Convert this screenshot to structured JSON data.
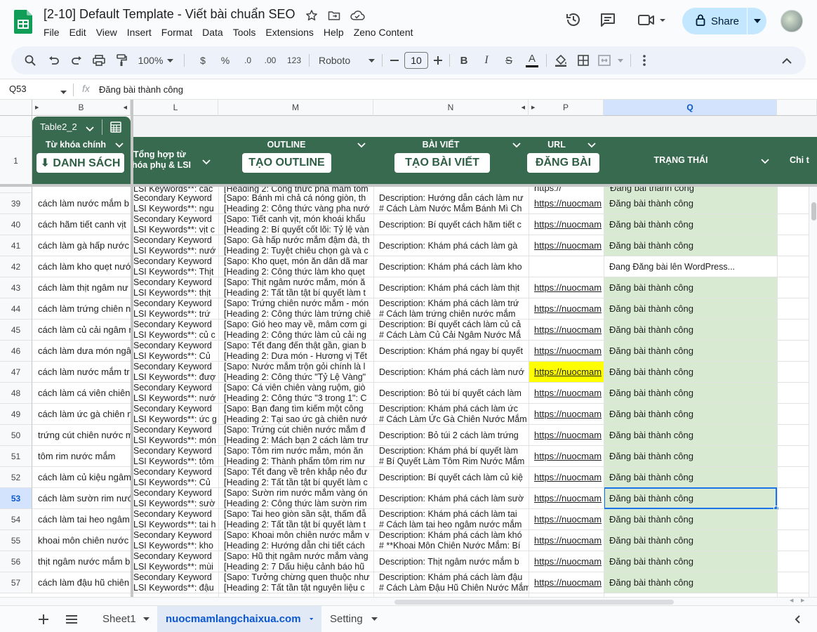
{
  "doc": {
    "title": "[2-10] Default Template - Viết bài chuẩn SEO",
    "menu": [
      "File",
      "Edit",
      "View",
      "Insert",
      "Format",
      "Data",
      "Tools",
      "Extensions",
      "Help",
      "Zeno Content"
    ],
    "share_label": "Share"
  },
  "toolbar": {
    "zoom": "100%",
    "currency": "$",
    "percent": "%",
    "dec_less": ".0",
    "dec_more": ".00",
    "number_format": "123",
    "font": "Roboto",
    "font_size": "10",
    "bold": "B",
    "italic": "I",
    "strike": "S",
    "text_color": "A"
  },
  "formula_bar": {
    "cell_ref": "Q53",
    "fx": "fx",
    "content": "Đăng bài thành công"
  },
  "columns": {
    "B": "B",
    "L": "L",
    "M": "M",
    "N": "N",
    "P": "P",
    "Q": "Q"
  },
  "table": {
    "chip_name": "Table2_2",
    "header_row_num": "1",
    "headers": {
      "B": "Từ khóa chính",
      "L_line1": "Tổng hợp từ",
      "L_line2": "hóa phụ & LSI",
      "M": "OUTLINE",
      "N": "BÀI VIẾT",
      "P": "URL",
      "Q": "TRẠNG THÁI",
      "R": "Chi t"
    },
    "buttons": {
      "B": "⬇ DANH SÁCH",
      "M": "TẠO OUTLINE",
      "N": "TẠO BÀI VIẾT",
      "P": "ĐĂNG BÀI"
    }
  },
  "top_partial": {
    "L": "LSI Keywords**: các",
    "M": "[Heading 2: Công thức pha mắm tôm",
    "N": "",
    "P": "https://",
    "Q": "Đăng bài thành công"
  },
  "rows": [
    {
      "num": "39",
      "B": "cách làm nước mắm b",
      "L1": "Secondary Keyword",
      "L2": "LSI Keywords**: ngu",
      "M1": "[Sapo: Bánh mì chả cá nóng giòn, th",
      "M2": "[Heading 2: Công thức vàng pha nướ",
      "N1": "Description: Hướng dẫn cách làm nư",
      "N2": "# Cách Làm Nước Mắm Bánh Mì Ch",
      "P": "https://nuocmam",
      "Q": "Đăng bài thành công"
    },
    {
      "num": "40",
      "B": "cách hãm tiết canh vịt",
      "L1": "Secondary Keyword",
      "L2": "LSI Keywords**: vịt c",
      "M1": "[Sapo: Tiết canh vịt, món khoái khẩu",
      "M2": "[Heading 2: Bí quyết cốt lõi: Tỷ lệ vàn",
      "N1": "Description: Bí quyết cách hãm tiết c",
      "N2": "",
      "P": "https://nuocmam",
      "Q": "Đăng bài thành công"
    },
    {
      "num": "41",
      "B": "cách làm gà hấp nước",
      "L1": "Secondary Keyword",
      "L2": "LSI Keywords**: nướ",
      "M1": "[Sapo: Gà hấp nước mắm đậm đà, th",
      "M2": "[Heading 2: Tuyệt chiêu chọn gà và c",
      "N1": "Description: Khám phá cách làm gà",
      "N2": "",
      "P": "https://nuocmam",
      "Q": "Đăng bài thành công"
    },
    {
      "num": "42",
      "B": "cách làm kho quẹt nước",
      "L1": "Secondary Keyword",
      "L2": "LSI Keywords**: Thịt",
      "M1": "[Sapo: Kho quẹt, món ăn dân dã mar",
      "M2": "[Heading 2: Công thức làm kho quẹt",
      "N1": "Description: Khám phá cách làm kho",
      "N2": "",
      "P": "",
      "Q": "Đang Đăng bài lên WordPress..."
    },
    {
      "num": "43",
      "B": "cách làm thịt ngâm nư",
      "L1": "Secondary Keyword",
      "L2": "LSI Keywords**: thịt",
      "M1": "[Sapo: Thịt ngâm nước mắm, món ă",
      "M2": "[Heading 2: Tất tần tật bí quyết làm t",
      "N1": "Description: Khám phá cách làm thịt",
      "N2": "",
      "P": "https://nuocmam",
      "Q": "Đăng bài thành công"
    },
    {
      "num": "44",
      "B": "cách làm trứng chiên n",
      "L1": "Secondary Keyword",
      "L2": "LSI Keywords**: trứ",
      "M1": "[Sapo: Trứng chiên nước mắm - món",
      "M2": "[Heading 2: Công thức làm trứng chiê",
      "N1": "Description: Khám phá cách làm trứ",
      "N2": "# Cách làm trứng chiên nước mắm",
      "P": "https://nuocmam",
      "Q": "Đăng bài thành công"
    },
    {
      "num": "45",
      "B": "cách làm củ cải ngâm r",
      "L1": "Secondary Keyword",
      "L2": "LSI Keywords**: củ c",
      "M1": "[Sapo: Gió heo may về, mâm cơm gi",
      "M2": "[Heading 2: Công thức làm củ cải ng",
      "N1": "Description: Bí quyết cách làm củ cả",
      "N2": "# Cách Làm Củ Cải Ngâm Nước Mắ",
      "P": "https://nuocmam",
      "Q": "Đăng bài thành công"
    },
    {
      "num": "46",
      "B": "cách làm dưa món ngâ",
      "L1": "Secondary Keyword",
      "L2": "LSI Keywords**: Củ",
      "M1": "[Sapo: Tết đang đến thật gần, gian b",
      "M2": "[Heading 2: Dưa món - Hương vị Tết",
      "N1": "Description: Khám phá ngay bí quyết",
      "N2": "",
      "P": "https://nuocmam",
      "Q": "Đăng bài thành công"
    },
    {
      "num": "47",
      "B": "cách làm nước mắm tr",
      "L1": "Secondary Keyword",
      "L2": "LSI Keywords**: đượ",
      "M1": "[Sapo: Nước mắm trộn gỏi chính là l",
      "M2": "[Heading 2: Công thức \"Tỷ Lệ Vàng\"",
      "N1": "Description: Khám phá cách làm nướ",
      "N2": "",
      "P": "https://nuocmam",
      "Q": "Đăng bài thành công"
    },
    {
      "num": "48",
      "B": "cách làm cá viên chiên",
      "L1": "Secondary Keyword",
      "L2": "LSI Keywords**: nướ",
      "M1": "[Sapo: Cá viên chiên vàng ruộm, giò",
      "M2": "[Heading 2: Công thức \"3 trong 1\": C",
      "N1": "Description: Bỏ túi bí quyết cách làm",
      "N2": "",
      "P": "https://nuocmam",
      "Q": "Đăng bài thành công"
    },
    {
      "num": "49",
      "B": "cách làm ức gà chiên n",
      "L1": "Secondary Keyword",
      "L2": "LSI Keywords**: ức g",
      "M1": "[Sapo: Bạn đang tìm kiếm một công",
      "M2": "[Heading 2: Tại sao ức gà chiên nướ",
      "N1": "Description: Khám phá cách làm ức",
      "N2": "# Cách Làm Ức Gà Chiên Nước Mắm",
      "P": "https://nuocmam",
      "Q": "Đăng bài thành công"
    },
    {
      "num": "50",
      "B": "trứng cút chiên nước m",
      "L1": "Secondary Keyword",
      "L2": "LSI Keywords**: món",
      "M1": "[Sapo: Trứng cút chiên nước mắm đ",
      "M2": "[Heading 2: Mách bạn 2 cách làm trư",
      "N1": "Description: Bỏ túi 2 cách làm trứng",
      "N2": "",
      "P": "https://nuocmam",
      "Q": "Đăng bài thành công"
    },
    {
      "num": "51",
      "B": "tôm rim nước mắm",
      "L1": "Secondary Keyword",
      "L2": "LSI Keywords**: tôm",
      "M1": "[Sapo: Tôm rim nước mắm, món ăn",
      "M2": "[Heading 2: Thành phẩm tôm rim nư",
      "N1": "Description: Khám phá bí quyết làm",
      "N2": "# Bí Quyết Làm Tôm Rim Nước Mắm",
      "P": "https://nuocmam",
      "Q": "Đăng bài thành công"
    },
    {
      "num": "52",
      "B": "cách làm củ kiệu ngâm",
      "L1": "Secondary Keyword",
      "L2": "LSI Keywords**: Củ",
      "M1": "[Sapo: Tết đang về trên khắp nẻo đư",
      "M2": "[Heading 2: Tất tần tật bí quyết làm c",
      "N1": "Description: Bí quyết cách làm củ kiệ",
      "N2": "",
      "P": "https://nuocmam",
      "Q": "Đăng bài thành công"
    },
    {
      "num": "53",
      "B": "cách làm sườn rim nướ",
      "L1": "Secondary Keyword",
      "L2": "LSI Keywords**: sườ",
      "M1": "[Sapo: Sườn rim nước mắm vàng ón",
      "M2": "[Heading 2: Công thức làm sườn rim",
      "N1": "Description: Khám phá cách làm sườ",
      "N2": "",
      "P": "https://nuocmam",
      "Q": "Đăng bài thành công"
    },
    {
      "num": "54",
      "B": "cách làm tai heo ngâm",
      "L1": "Secondary Keyword",
      "L2": "LSI Keywords**: tai h",
      "M1": "[Sapo: Tai heo giòn sần sật, thấm đẫ",
      "M2": "[Heading 2: Tất tần tật bí quyết làm t",
      "N1": "Description: Khám phá cách làm tai",
      "N2": "# Cách làm tai heo ngâm nước mắm",
      "P": "https://nuocmam",
      "Q": "Đăng bài thành công"
    },
    {
      "num": "55",
      "B": "khoai môn chiên nước",
      "L1": "Secondary Keyword",
      "L2": "LSI Keywords**: kho",
      "M1": "[Sapo: Khoai môn chiên nước mắm v",
      "M2": "[Heading 2: Hướng dẫn chi tiết cách",
      "N1": "Description: Khám phá cách làm khó",
      "N2": "# **Khoai Môn Chiên Nước Mắm: Bí",
      "P": "https://nuocmam",
      "Q": "Đăng bài thành công"
    },
    {
      "num": "56",
      "B": "thịt ngâm nước mắm b",
      "L1": "Secondary Keyword",
      "L2": "LSI Keywords**: mùi",
      "M1": "[Sapo: Hũ thịt ngâm nước mắm vàng",
      "M2": "[Heading 2: 7 Dấu hiệu cảnh báo hũ",
      "N1": "Description: Thịt ngâm nước mắm b",
      "N2": "",
      "P": "https://nuocmam",
      "Q": "Đăng bài thành công"
    },
    {
      "num": "57",
      "B": "cách làm đậu hũ chiên",
      "L1": "Secondary Keyword",
      "L2": "LSI Keywords**: đậu",
      "M1": "[Sapo: Tưởng chừng quen thuộc như",
      "M2": "[Heading 2: Tất tần tật nguyên liệu c",
      "N1": "Description: Khám phá cách làm đậu",
      "N2": "# Cách Làm Đậu Hũ Chiên Nước Mắm",
      "P": "https://nuocmam",
      "Q": "Đăng bài thành công"
    }
  ],
  "sheets": [
    "Sheet1",
    "nuocmamlangchaixua.com",
    "Setting"
  ],
  "colors": {
    "table_header": "#386a4f",
    "success_fill": "#d9ead3",
    "highlight": "#ffff00",
    "selection": "#1a73e8",
    "share_bg": "#c2e7ff"
  }
}
